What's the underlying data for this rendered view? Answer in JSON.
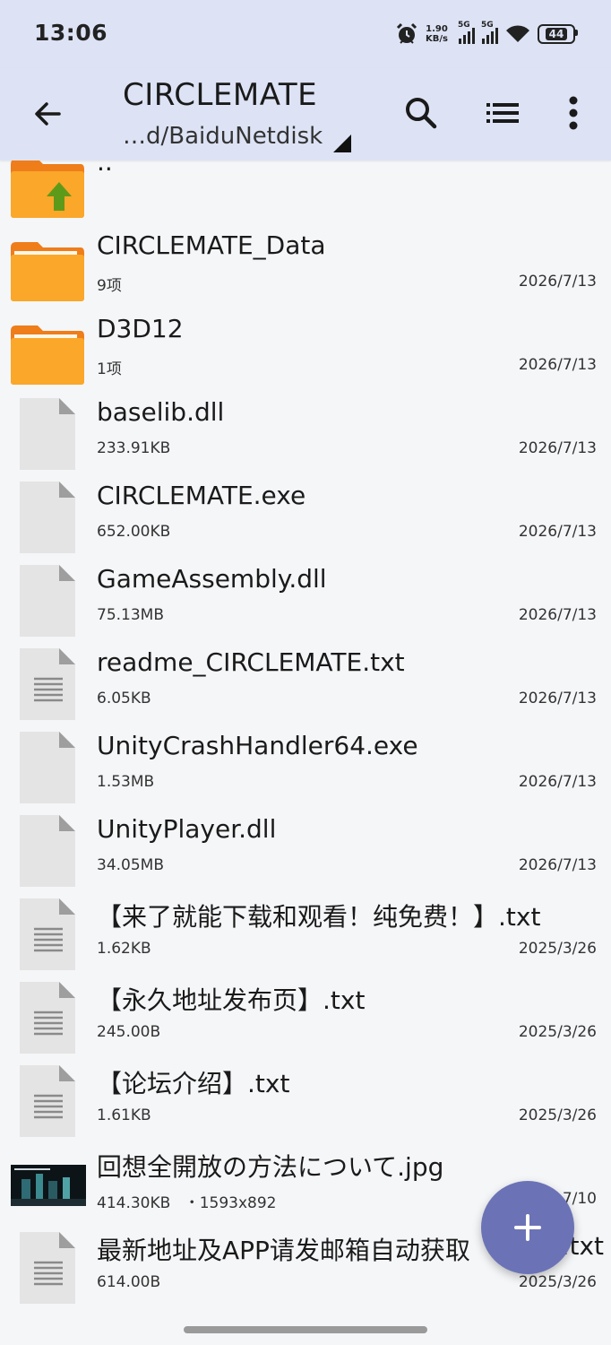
{
  "status": {
    "time": "13:06",
    "net_speed_value": "1.90",
    "net_speed_unit": "KB/s",
    "signal1": "5G",
    "signal2": "5G",
    "battery": "44"
  },
  "toolbar": {
    "title": "CIRCLEMATE",
    "path": "…d/BaiduNetdisk",
    "icons": [
      "back-arrow-icon",
      "search-icon",
      "list-view-icon",
      "more-vert-icon"
    ]
  },
  "colors": {
    "folder": "#fba72a",
    "folder_tab": "#ef7d1a",
    "up_arrow": "#5e9a1a",
    "file_page": "#e4e4e4",
    "fab": "#6b73b6",
    "appbar": "#dde3f5"
  },
  "files": [
    {
      "name": "..",
      "size": "",
      "date": "",
      "type": "parent-folder"
    },
    {
      "name": "CIRCLEMATE_Data",
      "size": "9项",
      "date": "2026/7/13",
      "type": "folder"
    },
    {
      "name": "D3D12",
      "size": "1项",
      "date": "2026/7/13",
      "type": "folder"
    },
    {
      "name": "baselib.dll",
      "size": "233.91KB",
      "date": "2026/7/13",
      "type": "file"
    },
    {
      "name": "CIRCLEMATE.exe",
      "size": "652.00KB",
      "date": "2026/7/13",
      "type": "file"
    },
    {
      "name": "GameAssembly.dll",
      "size": "75.13MB",
      "date": "2026/7/13",
      "type": "file"
    },
    {
      "name": "readme_CIRCLEMATE.txt",
      "size": "6.05KB",
      "date": "2026/7/13",
      "type": "text"
    },
    {
      "name": "UnityCrashHandler64.exe",
      "size": "1.53MB",
      "date": "2026/7/13",
      "type": "file"
    },
    {
      "name": "UnityPlayer.dll",
      "size": "34.05MB",
      "date": "2026/7/13",
      "type": "file"
    },
    {
      "name": "【来了就能下载和观看！纯免费！】.txt",
      "size": "1.62KB",
      "date": "2025/3/26",
      "type": "text"
    },
    {
      "name": "【永久地址发布页】.txt",
      "size": "245.00B",
      "date": "2025/3/26",
      "type": "text"
    },
    {
      "name": "【论坛介绍】.txt",
      "size": "1.61KB",
      "date": "2025/3/26",
      "type": "text"
    },
    {
      "name": "回想全開放の方法について.jpg",
      "size": "414.30KB",
      "extra": "・1593x892",
      "date": "7/10",
      "type": "image"
    },
    {
      "name": "最新地址及APP请发邮箱自动获取",
      "name_tail": ".txt",
      "size": "614.00B",
      "date": "2025/3/26",
      "type": "text"
    }
  ],
  "fab": {
    "icon": "plus-icon"
  }
}
